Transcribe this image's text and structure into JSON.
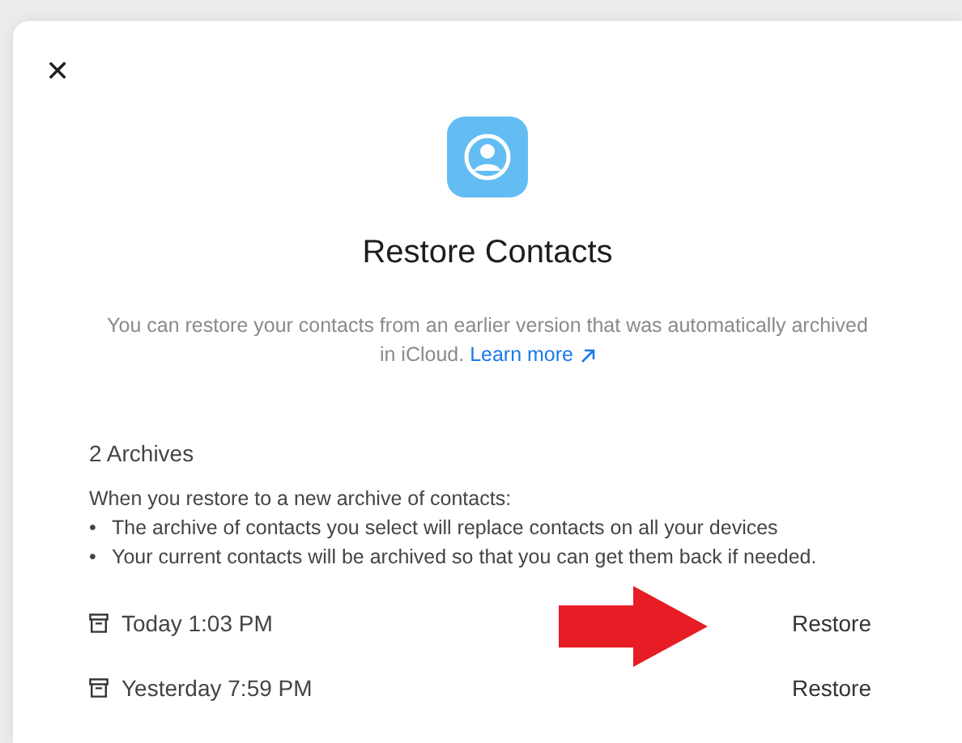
{
  "dialog": {
    "close": "✕",
    "title": "Restore Contacts",
    "description": "You can restore your contacts from an earlier version that was automatically archived in iCloud.",
    "link": "Learn more"
  },
  "archives": {
    "heading": "2 Archives",
    "intro": "When you restore to a new archive of contacts:",
    "bullets": [
      {
        "marker": "•",
        "text": "The archive of contacts you select will replace contacts on all your devices"
      },
      {
        "marker": "•",
        "text": "Your current contacts will be archived so that you can get them back if needed."
      }
    ],
    "items": [
      {
        "label": "Today 1:03 PM",
        "action": "Restore"
      },
      {
        "label": "Yesterday 7:59 PM",
        "action": "Restore"
      }
    ]
  }
}
